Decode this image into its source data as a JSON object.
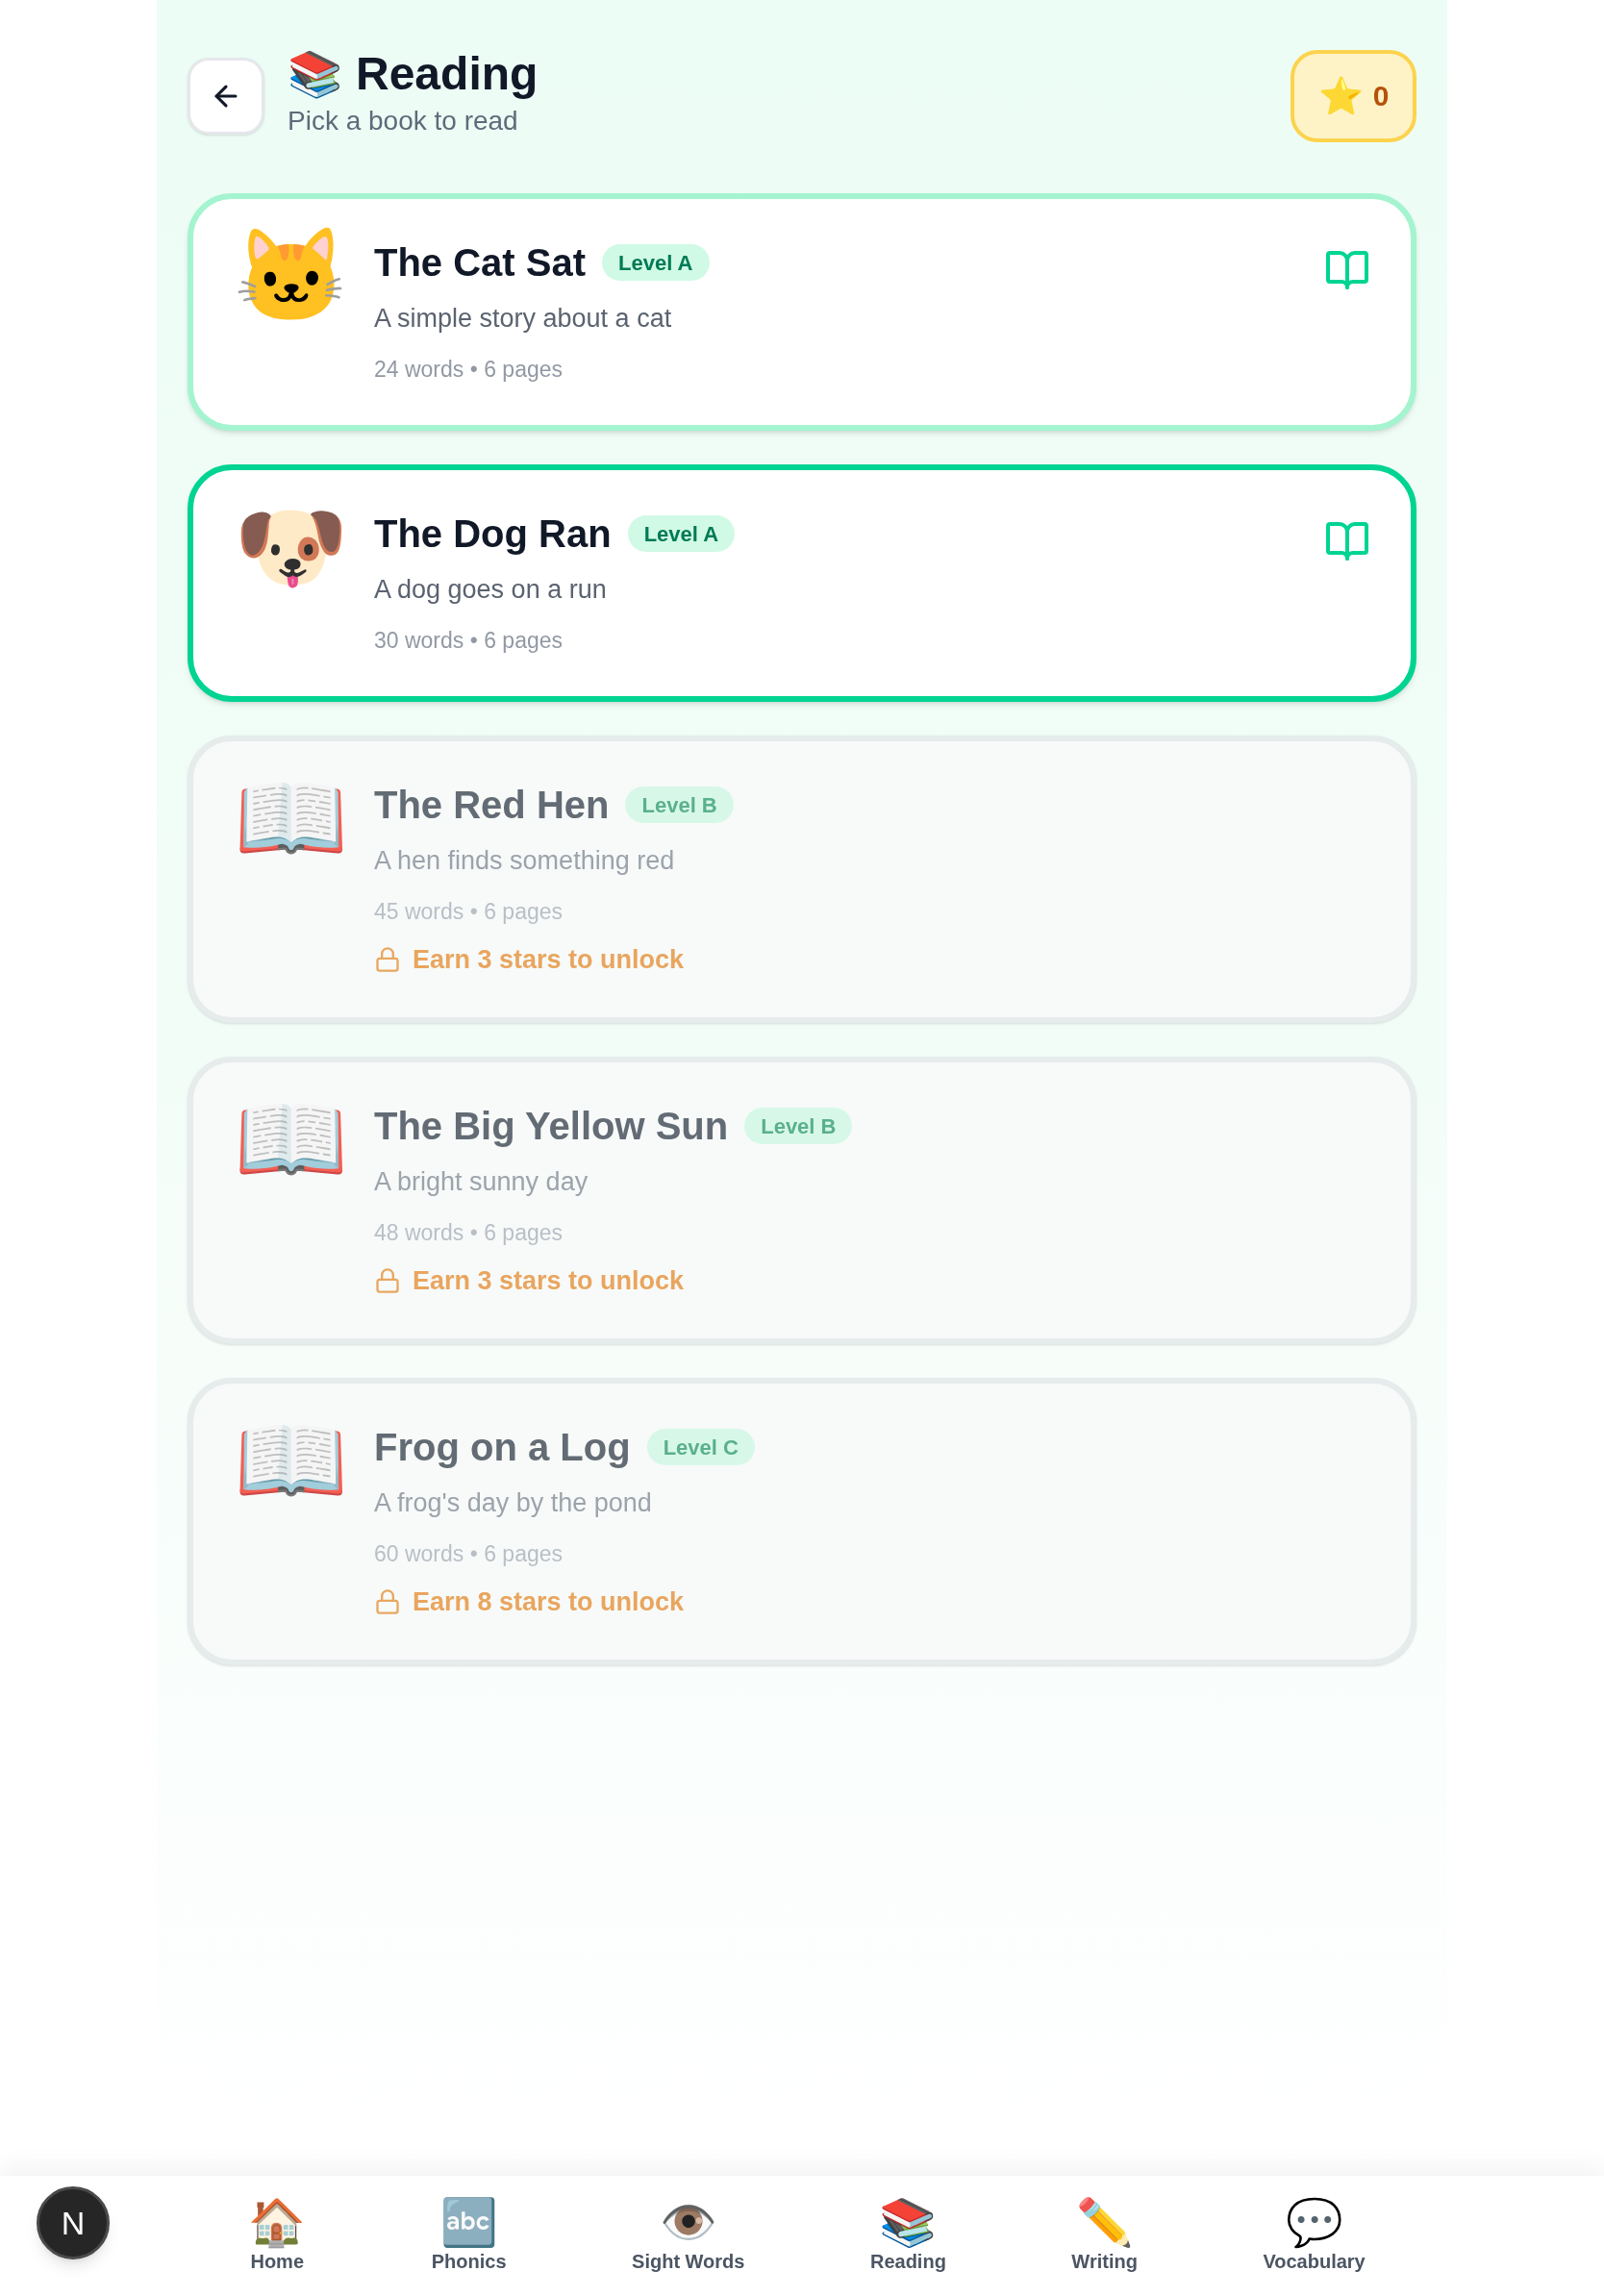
{
  "header": {
    "title_icon": "📚",
    "title": "Reading",
    "subtitle": "Pick a book to read",
    "stars": {
      "icon": "⭐",
      "count": "0"
    }
  },
  "books": [
    {
      "cover": "🐱",
      "title": "The Cat Sat",
      "level": "Level A",
      "description": "A simple story about a cat",
      "meta": "24 words • 6 pages",
      "locked": false,
      "selected": false
    },
    {
      "cover": "🐶",
      "title": "The Dog Ran",
      "level": "Level A",
      "description": "A dog goes on a run",
      "meta": "30 words • 6 pages",
      "locked": false,
      "selected": true
    },
    {
      "cover": "📖",
      "title": "The Red Hen",
      "level": "Level B",
      "description": "A hen finds something red",
      "meta": "45 words • 6 pages",
      "locked": true,
      "selected": false,
      "unlock_hint": "Earn 3 stars to unlock"
    },
    {
      "cover": "📖",
      "title": "The Big Yellow Sun",
      "level": "Level B",
      "description": "A bright sunny day",
      "meta": "48 words • 6 pages",
      "locked": true,
      "selected": false,
      "unlock_hint": "Earn 3 stars to unlock"
    },
    {
      "cover": "📖",
      "title": "Frog on a Log",
      "level": "Level C",
      "description": "A frog's day by the pond",
      "meta": "60 words • 6 pages",
      "locked": true,
      "selected": false,
      "unlock_hint": "Earn 8 stars to unlock"
    }
  ],
  "nav": [
    {
      "icon": "🏠",
      "label": "Home"
    },
    {
      "icon": "🔤",
      "label": "Phonics"
    },
    {
      "icon": "👁️",
      "label": "Sight Words"
    },
    {
      "icon": "📚",
      "label": "Reading"
    },
    {
      "icon": "✏️",
      "label": "Writing"
    },
    {
      "icon": "💬",
      "label": "Vocabulary"
    }
  ],
  "floating_button": {
    "label": "N"
  }
}
